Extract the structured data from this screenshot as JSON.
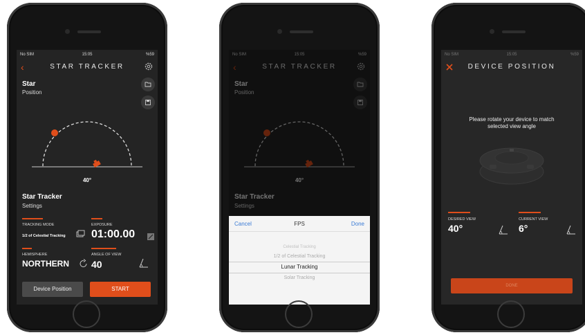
{
  "common": {
    "app_title": "STAR TRACKER",
    "status_carrier": "No SIM",
    "status_time": "15:05",
    "status_battery": "%59"
  },
  "screen1": {
    "star_title": "Star",
    "star_subtitle": "Position",
    "angle_label": "40°",
    "tracker_title": "Star Tracker",
    "tracker_subtitle": "Settings",
    "tracking_mode_label": "TRACKING MODE",
    "tracking_mode_value": "1/2 of Celestial Tracking",
    "exposure_label": "EXPOSURE",
    "exposure_value": "01:00.00",
    "hemisphere_label": "HEMISPHERE",
    "hemisphere_value": "NORTHERN",
    "angle_of_view_label": "ANGLE OF VIEW",
    "angle_of_view_value": "40",
    "device_position_button": "Device Position",
    "start_button": "START"
  },
  "screen2": {
    "picker_cancel": "Cancel",
    "picker_title": "FPS",
    "picker_done": "Done",
    "options": [
      "Celestial Tracking",
      "1/2 of Celestial Tracking",
      "Lunar Tracking",
      "Solar Tracking"
    ],
    "selected_option": "Lunar Tracking"
  },
  "screen3": {
    "title": "DEVICE POSITION",
    "instruction": "Please rotate your device to match selected view angle",
    "desired_view_label": "DESIRED VIEW",
    "desired_view_value": "40°",
    "current_view_label": "CURRENT VIEW",
    "current_view_value": "6°",
    "done_button": "DONE"
  },
  "colors": {
    "accent": "#e04e1b",
    "screen_bg": "#242424",
    "picker_link": "#3a7bd5"
  },
  "icons": [
    "back-chevron-icon",
    "gear-icon",
    "folder-icon",
    "save-icon",
    "layers-icon",
    "edit-icon",
    "rotate-icon",
    "angle-icon",
    "close-icon",
    "device-icon"
  ]
}
